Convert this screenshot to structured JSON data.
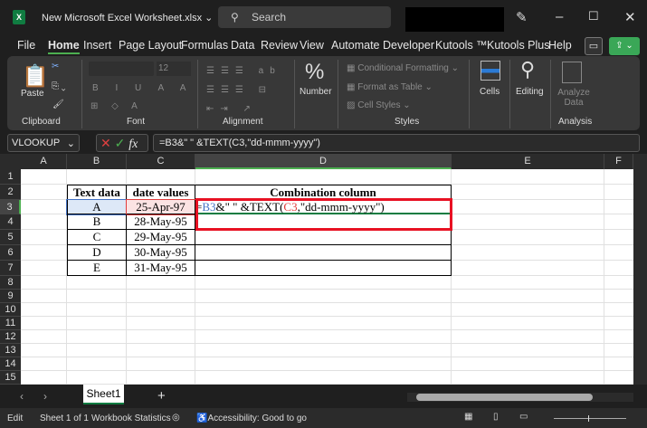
{
  "title": {
    "file_name": "New Microsoft Excel Worksheet.xlsx",
    "search_placeholder": "Search"
  },
  "menu": [
    "File",
    "Home",
    "Insert",
    "Page Layout",
    "Formulas",
    "Data",
    "Review",
    "View",
    "Automate",
    "Developer",
    "Kutools ™",
    "Kutools Plus",
    "Help"
  ],
  "ribbon": {
    "paste": "Paste",
    "clipboard": "Clipboard",
    "font_size": "12",
    "font": "Font",
    "alignment": "Alignment",
    "number": "Number",
    "conditional_formatting": "Conditional Formatting",
    "format_as_table": "Format as Table",
    "cell_styles": "Cell Styles",
    "styles": "Styles",
    "cells": "Cells",
    "editing": "Editing",
    "analyze_data": "Analyze Data",
    "analysis": "Analysis"
  },
  "formula_bar": {
    "name_box": "VLOOKUP",
    "formula": "=B3&\" \" &TEXT(C3,\"dd-mmm-yyyy\")"
  },
  "columns": [
    "A",
    "B",
    "C",
    "D",
    "E",
    "F"
  ],
  "rows": [
    "1",
    "2",
    "3",
    "4",
    "5",
    "6",
    "7",
    "8",
    "9",
    "10",
    "11",
    "12",
    "13",
    "14",
    "15"
  ],
  "table": {
    "headers": [
      "Text data",
      "date values",
      "Combination column"
    ],
    "rows": [
      [
        "A",
        "25-Apr-97"
      ],
      [
        "B",
        "28-May-95"
      ],
      [
        "C",
        "29-May-95"
      ],
      [
        "D",
        "30-May-95"
      ],
      [
        "E",
        "31-May-95"
      ]
    ]
  },
  "edit_cell": {
    "eq": "=",
    "ref1": "B3",
    "mid": "&\" \" &TEXT(",
    "ref2": "C3",
    "tail": ",\"dd-mmm-yyyy\")"
  },
  "sheet_tab": "Sheet1",
  "status": {
    "mode": "Edit",
    "sheet": "Sheet 1 of 1",
    "stats": "Workbook Statistics",
    "accessibility": "Accessibility: Good to go"
  },
  "colors": {
    "accent": "#107c41",
    "highlight": "#e81123",
    "ref_blue": "#4472c4",
    "ref_red": "#e03c3c"
  }
}
